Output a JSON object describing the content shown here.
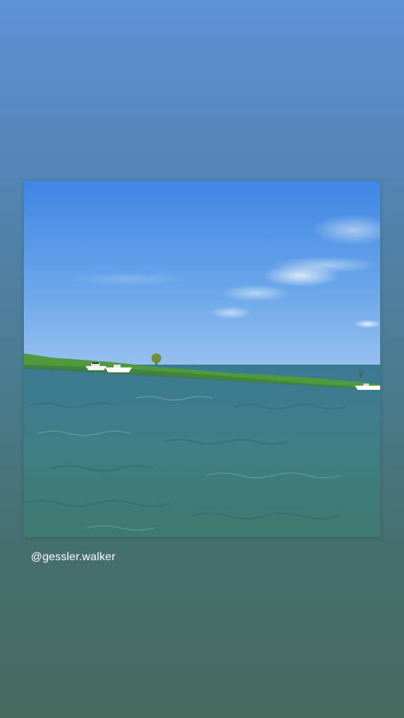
{
  "story": {
    "background_top": "#5f91d7",
    "background_bottom": "#476a5f",
    "photo": {
      "subject": "lake-scene",
      "sky_color": "#5b97e6",
      "water_color": "#3f7d85",
      "shoreline_color": "#4f9a3f"
    },
    "mention": "@gessler.walker"
  }
}
